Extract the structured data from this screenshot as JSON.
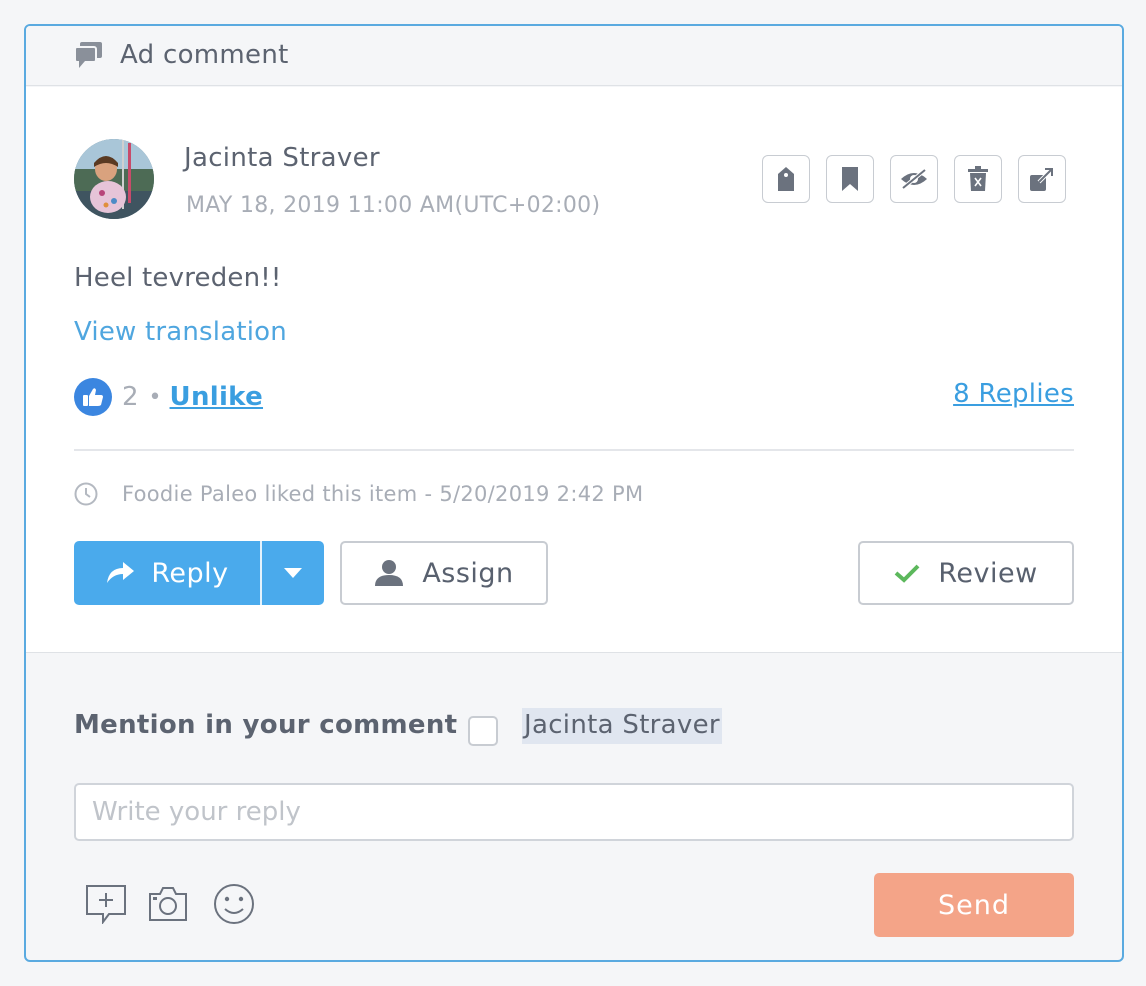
{
  "header": {
    "title": "Ad comment",
    "icon": "chat-bubbles-icon"
  },
  "comment": {
    "author": "Jacinta Straver",
    "timestamp": "MAY 18, 2019 11:00 AM(UTC+02:00)",
    "text": "Heel tevreden!!",
    "view_translation": "View translation",
    "like_count": "2",
    "like_separator": "•",
    "unlike_label": "Unlike",
    "replies_label": "8 Replies"
  },
  "action_icons": [
    "tag-icon",
    "bookmark-icon",
    "hide-icon",
    "delete-icon",
    "open-external-icon"
  ],
  "activity": {
    "text": "Foodie Paleo liked this item - 5/20/2019 2:42 PM",
    "icon": "clock-icon"
  },
  "buttons": {
    "reply": "Reply",
    "assign": "Assign",
    "review": "Review"
  },
  "composer": {
    "mention_label": "Mention in your comment",
    "mention_name": "Jacinta Straver",
    "mention_checked": false,
    "placeholder": "Write your reply",
    "value": "",
    "send": "Send",
    "tools": [
      "add-note-icon",
      "camera-icon",
      "emoji-icon"
    ]
  },
  "colors": {
    "accent": "#4aaaec",
    "link": "#3a9ee0",
    "send": "#f4a488",
    "border": "#5aaae0",
    "like": "#3b86e0",
    "check": "#5cb85c"
  }
}
